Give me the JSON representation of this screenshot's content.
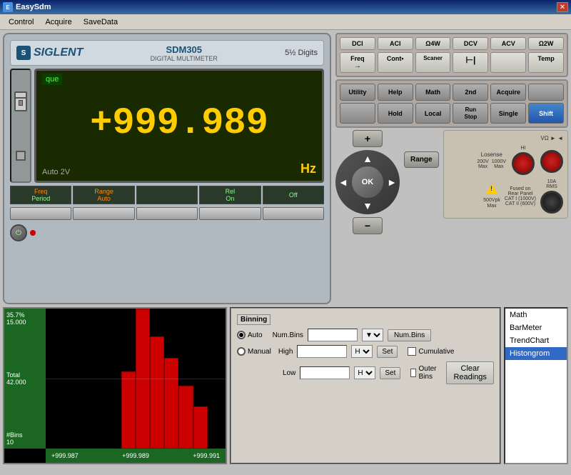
{
  "window": {
    "title": "EasySdm",
    "close_label": "✕"
  },
  "menu": {
    "items": [
      "Control",
      "Acquire",
      "SaveData"
    ]
  },
  "multimeter": {
    "logo": "⊞ SIGLENT",
    "model_name": "SDM305",
    "model_sub": "DIGITAL MULTIMETER",
    "digits": "5½ Digits",
    "display_label": "que",
    "reading": "+999.989",
    "auto_range": "Auto 2V",
    "unit": "Hz",
    "softkeys": [
      {
        "top": "Freq",
        "bottom": "Period",
        "color": "orange"
      },
      {
        "top": "Range",
        "bottom": "Auto",
        "color": "orange"
      },
      {
        "top": "",
        "bottom": ""
      },
      {
        "top": "Rel",
        "bottom": "On",
        "color": "normal"
      },
      {
        "top": "",
        "bottom": "Off",
        "color": "normal"
      }
    ]
  },
  "meas_buttons": [
    {
      "label": "DCI"
    },
    {
      "label": "ACI"
    },
    {
      "label": "Ω4W"
    },
    {
      "label": "DCV"
    },
    {
      "label": "ACV"
    },
    {
      "label": "Ω2W"
    },
    {
      "label": "Freq",
      "sub": "→"
    },
    {
      "label": "Cont•"
    },
    {
      "label": "Scaner"
    },
    {
      "label": "⊢|"
    },
    {
      "label": ""
    },
    {
      "label": "Temp"
    }
  ],
  "func_buttons": [
    {
      "label": "Utility"
    },
    {
      "label": "Help"
    },
    {
      "label": "Math"
    },
    {
      "label": "2nd"
    },
    {
      "label": "Acquire"
    },
    {
      "label": ""
    },
    {
      "label": ""
    },
    {
      "label": "Hold"
    },
    {
      "label": "Local"
    },
    {
      "label": "Run\nStop"
    },
    {
      "label": "Single"
    },
    {
      "label": "Shift",
      "style": "blue"
    }
  ],
  "nav": {
    "ok_label": "OK",
    "plus_label": "+",
    "minus_label": "−",
    "range_label": "Range",
    "arrows": [
      "▲",
      "▼",
      "◄",
      "►"
    ]
  },
  "histogram": {
    "labels": [
      {
        "text": "35.7%"
      },
      {
        "text": "15.000"
      },
      {
        "text": "Total"
      },
      {
        "text": "42.000"
      },
      {
        "text": "#Bins"
      },
      {
        "text": "10"
      }
    ],
    "x_labels": [
      "+999.987",
      "+999.989",
      "+999.991"
    ],
    "bars": [
      {
        "left_pct": 42,
        "width_pct": 8,
        "height_pct": 55
      },
      {
        "left_pct": 50,
        "width_pct": 8,
        "height_pct": 100
      },
      {
        "left_pct": 58,
        "width_pct": 8,
        "height_pct": 80
      },
      {
        "left_pct": 66,
        "width_pct": 8,
        "height_pct": 65
      },
      {
        "left_pct": 74,
        "width_pct": 8,
        "height_pct": 45
      },
      {
        "left_pct": 82,
        "width_pct": 8,
        "height_pct": 30
      }
    ]
  },
  "binning": {
    "title": "Binning",
    "auto_label": "Auto",
    "manual_label": "Manual",
    "numbins_label": "Num.Bins",
    "high_label": "High",
    "low_label": "Low",
    "hz_label": "Hz",
    "set_label": "Set",
    "numbins_btn_label": "Num.Bins",
    "cumulative_label": "Cumulative",
    "outer_bins_label": "Outer Bins",
    "clear_label": "Clear Readings"
  },
  "right_list": {
    "items": [
      "Math",
      "BarMeter",
      "TrendChart",
      "Histongrom"
    ],
    "selected_index": 3
  }
}
